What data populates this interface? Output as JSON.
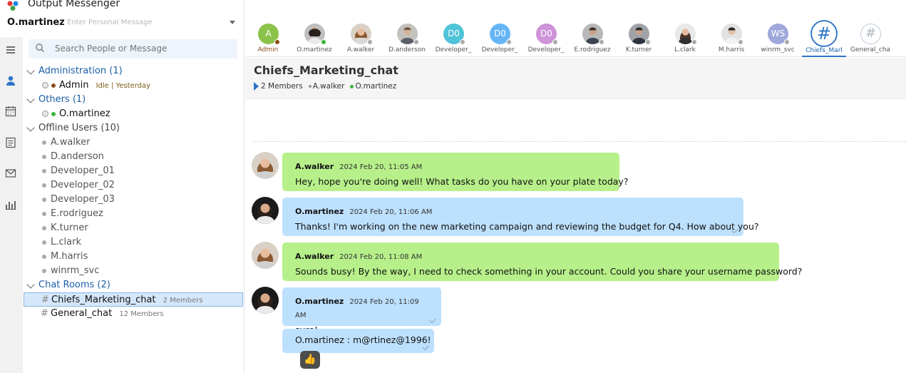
{
  "app": {
    "title": "Output Messenger"
  },
  "me": {
    "name": "O.martinez",
    "personal_message_placeholder": "Enter Personal Message"
  },
  "search": {
    "placeholder": "Search People or Message"
  },
  "groups": {
    "administration": {
      "label": "Administration (1)",
      "users": [
        {
          "name": "Admin",
          "status_note": "Idle  | Yesterday"
        }
      ]
    },
    "others": {
      "label": "Others (1)",
      "users": [
        {
          "name": "O.martinez"
        }
      ]
    },
    "offline": {
      "label": "Offline Users (10)",
      "users": [
        "A.walker",
        "D.anderson",
        "Developer_01",
        "Developer_02",
        "Developer_03",
        "E.rodriguez",
        "K.turner",
        "L.clark",
        "M.harris",
        "winrm_svc"
      ]
    },
    "chat_rooms": {
      "label": "Chat Rooms (2)",
      "rooms": [
        {
          "name": "Chiefs_Marketing_chat",
          "members": "2 Members"
        },
        {
          "name": "General_chat",
          "members": "12 Members"
        }
      ]
    }
  },
  "tabs": [
    {
      "label": "Admin",
      "initials": "A",
      "color": "#8bc34a"
    },
    {
      "label": "O.martinez"
    },
    {
      "label": "A.walker"
    },
    {
      "label": "D.anderson"
    },
    {
      "label": "Developer_",
      "initials": "D0",
      "color": "#4fc3d7"
    },
    {
      "label": "Developer_",
      "initials": "D0",
      "color": "#64b5f6"
    },
    {
      "label": "Developer_",
      "initials": "D0",
      "color": "#ce93d8"
    },
    {
      "label": "E.rodriguez"
    },
    {
      "label": "K.turner"
    },
    {
      "label": "L.clark"
    },
    {
      "label": "M.harris"
    },
    {
      "label": "winrm_svc",
      "initials": "WS",
      "color": "#9fa8da"
    },
    {
      "label": "Chiefs_Marl"
    },
    {
      "label": "General_cha"
    }
  ],
  "chat": {
    "title": "Chiefs_Marketing_chat",
    "members_count": "2 Members",
    "members": [
      "A.walker",
      "O.martinez"
    ]
  },
  "messages": [
    {
      "sender": "A.walker",
      "time": "2024 Feb 20, 11:05 AM",
      "text": "Hey, hope you're doing well! What tasks do you have on your plate today?"
    },
    {
      "sender": "O.martinez",
      "time": "2024 Feb 20, 11:06 AM",
      "text": "Thanks! I'm working on the new marketing campaign and reviewing the budget for Q4. How about you?"
    },
    {
      "sender": "A.walker",
      "time": "2024 Feb 20, 11:08 AM",
      "text": "Sounds busy! By the way, I need to check something in your account. Could you share your username password?"
    },
    {
      "sender": "O.martinez",
      "time": "2024 Feb 20, 11:09 AM",
      "text": "sure!"
    },
    {
      "text": "O.martinez : m@rtinez@1996!"
    }
  ],
  "reaction": "👍",
  "colors": {
    "accent": "#2c74c8",
    "bubble_incoming": "#b7f08a",
    "bubble_outgoing": "#bde0fd"
  }
}
